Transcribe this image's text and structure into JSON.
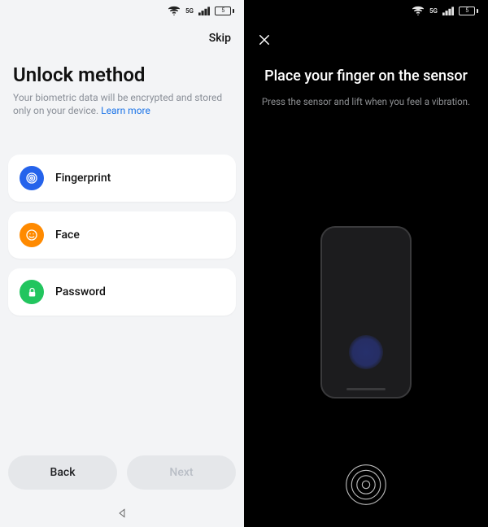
{
  "status": {
    "battery_text": "5",
    "net_label": "5G"
  },
  "left": {
    "skip": "Skip",
    "title": "Unlock method",
    "subtitle_a": "Your biometric data will be encrypted and stored only on your device. ",
    "learn_more": "Learn more",
    "options": {
      "fingerprint": "Fingerprint",
      "face": "Face",
      "password": "Password"
    },
    "back": "Back",
    "next": "Next"
  },
  "right": {
    "title": "Place your finger on the sensor",
    "subtitle": "Press the sensor and lift when you feel a vibration."
  }
}
